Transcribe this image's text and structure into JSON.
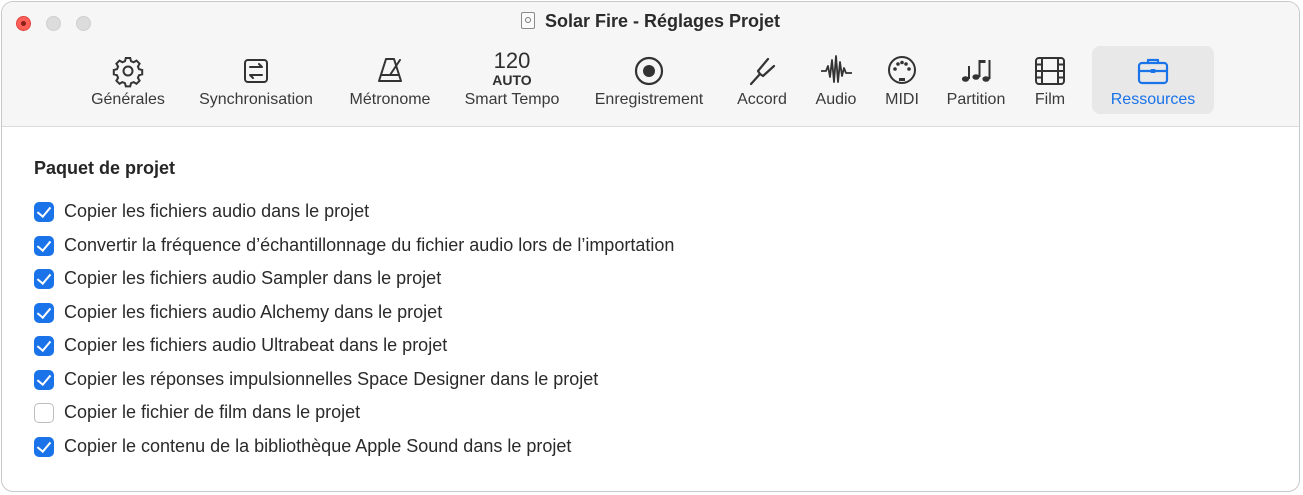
{
  "window": {
    "title": "Solar Fire - Réglages Projet"
  },
  "toolbar": {
    "items": [
      {
        "id": "generales",
        "label": "Générales",
        "icon": "gear-icon"
      },
      {
        "id": "synchronisation",
        "label": "Synchronisation",
        "icon": "sync-icon"
      },
      {
        "id": "metronome",
        "label": "Métronome",
        "icon": "metronome-icon"
      },
      {
        "id": "smart-tempo",
        "label": "Smart Tempo",
        "tempo_value": "120",
        "tempo_mode": "AUTO"
      },
      {
        "id": "enregistrement",
        "label": "Enregistrement",
        "icon": "record-icon"
      },
      {
        "id": "accord",
        "label": "Accord",
        "icon": "tuning-fork-icon"
      },
      {
        "id": "audio",
        "label": "Audio",
        "icon": "waveform-icon"
      },
      {
        "id": "midi",
        "label": "MIDI",
        "icon": "midi-port-icon"
      },
      {
        "id": "partition",
        "label": "Partition",
        "icon": "notes-icon"
      },
      {
        "id": "film",
        "label": "Film",
        "icon": "film-icon"
      },
      {
        "id": "ressources",
        "label": "Ressources",
        "icon": "briefcase-icon",
        "selected": true
      }
    ]
  },
  "accent_color": "#1a73e8",
  "section": {
    "title": "Paquet de projet",
    "options": [
      {
        "label": "Copier les fichiers audio dans le projet",
        "checked": true
      },
      {
        "label": "Convertir la fréquence d’échantillonnage du fichier audio lors de l’importation",
        "checked": true
      },
      {
        "label": "Copier les fichiers audio Sampler dans le projet",
        "checked": true
      },
      {
        "label": "Copier les fichiers audio Alchemy dans le projet",
        "checked": true
      },
      {
        "label": "Copier les fichiers audio Ultrabeat dans le projet",
        "checked": true
      },
      {
        "label": "Copier les réponses impulsionnelles Space Designer dans le projet",
        "checked": true
      },
      {
        "label": "Copier le fichier de film dans le projet",
        "checked": false
      },
      {
        "label": "Copier le contenu de la bibliothèque Apple Sound dans le projet",
        "checked": true
      }
    ]
  }
}
